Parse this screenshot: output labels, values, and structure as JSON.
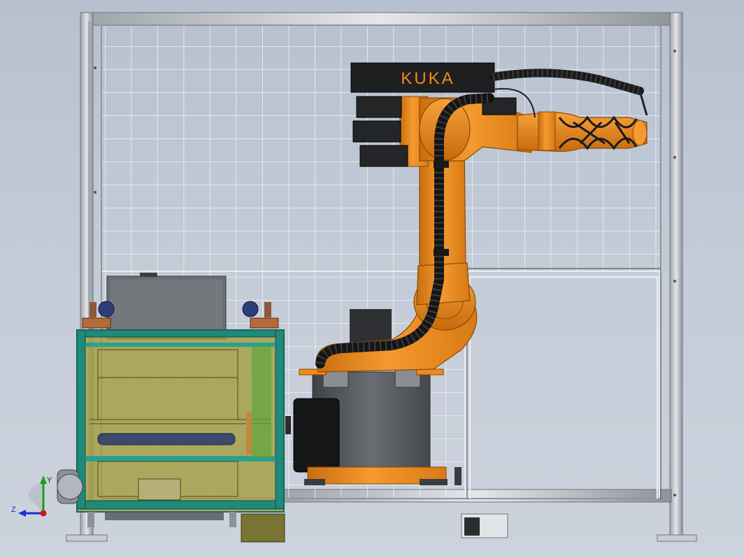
{
  "scene": {
    "robot_brand_label": "KUKA",
    "triad": {
      "y_label": "Y",
      "z_label": "Z"
    }
  },
  "colors": {
    "background": "#c1c9d5",
    "frame": "#c7cbd2",
    "frame_edge": "#6f747c",
    "mesh": "#f2f3f5",
    "robot_orange": "#f08a1c",
    "robot_orange_dark": "#b25f0a",
    "cable": "#1b1b1b",
    "motor": "#2a2a2a",
    "base_grey": "#55585e",
    "cabinet_green": "#1f8a7a",
    "cabinet_fill": "#9f9a3a",
    "axis_x": "#d01818",
    "axis_y": "#18a018",
    "axis_z": "#1830d0"
  },
  "icons": [
    "coordinate-triad-icon"
  ]
}
